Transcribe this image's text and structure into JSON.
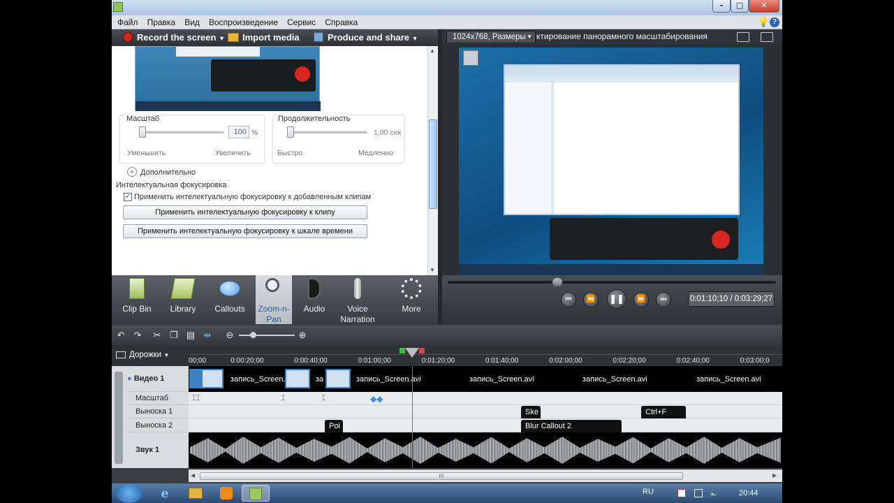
{
  "menu": [
    "Файл",
    "Правка",
    "Вид",
    "Воспроизведение",
    "Сервис",
    "Справка"
  ],
  "toolbar": {
    "record_label": "Record the screen",
    "import_label": "Import media",
    "produce_label": "Produce and share"
  },
  "zoom_panel": {
    "scale_label": "Масштаб",
    "scale_value": "100",
    "scale_unit": "%",
    "decrease_label": "Уменьшить",
    "increase_label": "Увеличить",
    "duration_label": "Продолжительность",
    "duration_value": "1,00 сек",
    "fast_label": "Быстро",
    "slow_label": "Медленно",
    "advanced_label": "Дополнительно",
    "smart_focus_label": "Интелектуальная фокусировка",
    "apply_added_label": "Применить интелектуальную фокусировку к добавленным клипам",
    "apply_added_checked": true,
    "apply_clip_btn": "Применить интелектуальную фокусировку к клипу",
    "apply_timeline_btn": "Применить интелектуальную фокусировку к шкале времени"
  },
  "tabs": [
    {
      "label": "Clip Bin",
      "icon": "clip-bin-icon"
    },
    {
      "label": "Library",
      "icon": "library-icon"
    },
    {
      "label": "Callouts",
      "icon": "callouts-icon"
    },
    {
      "label": "Zoom-n-\nPan",
      "icon": "zoom-icon",
      "active": true
    },
    {
      "label": "Audio",
      "icon": "audio-icon"
    },
    {
      "label": "Voice\nNarration",
      "icon": "microphone-icon"
    },
    {
      "label": "More",
      "icon": "more-icon"
    }
  ],
  "preview": {
    "size_dropdown": "1024x768, Размеры",
    "title": "ктирование панорамного масштабирования",
    "time": "0:01:10;10 / 0:03:29;27",
    "progress": 0.34
  },
  "timeline": {
    "tracks_label": "Дорожки",
    "ticks": [
      "00;00",
      "0:00:20;00",
      "0:00:40;00",
      "0:01:00;00",
      "0:01:20;00",
      "0:01:40;00",
      "0:02:00;00",
      "0:02:20;00",
      "0:02:40;00",
      "0:03:00;0"
    ],
    "track_names": [
      "Видео 1",
      "Масштаб",
      "Выноска 1",
      "Выноска 2",
      "Звук 1"
    ],
    "video_clips": [
      "запись_Screen.",
      "за",
      "запись_Screen.avi",
      "запись_Screen.avi",
      "запись_Screen.avi",
      "запись_Screen.avi"
    ],
    "callout1": [
      "Ske",
      "Ctrl+F"
    ],
    "callout2": [
      "Poi",
      "Blur Callout 2"
    ],
    "hscroll_grip": "III"
  },
  "taskbar": {
    "lang": "RU",
    "clock": "20:44"
  },
  "colors": {
    "accent": "#5aa0e6",
    "tab_active": "#cfd3d9",
    "red_record": "#d7261f"
  }
}
